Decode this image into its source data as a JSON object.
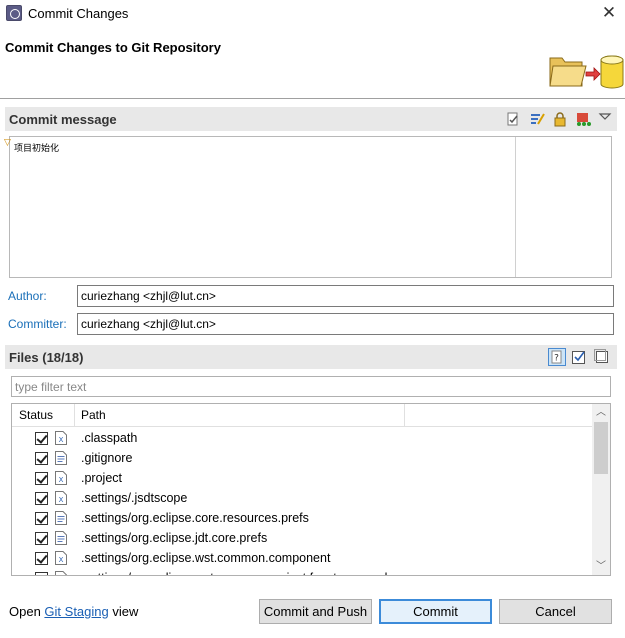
{
  "window": {
    "title": "Commit Changes",
    "close_glyph": "✕"
  },
  "banner": {
    "title": "Commit Changes to Git Repository",
    "icon": "folder-to-repository-icon"
  },
  "commit_message": {
    "header": "Commit message",
    "toolbar_icons": [
      "spell-check-icon",
      "amend-icon",
      "sign-off-icon",
      "commit-settings-icon",
      "dropdown-icon"
    ],
    "text": "项目初始化",
    "marker": "▽"
  },
  "author": {
    "label": "Author:",
    "value": "curiezhang <zhjl@lut.cn>"
  },
  "committer": {
    "label": "Committer:",
    "value": "curiezhang <zhjl@lut.cn>"
  },
  "files": {
    "header": "Files (18/18)",
    "toolbar_icons": [
      "show-untracked-icon",
      "select-all-icon",
      "deselect-all-icon"
    ],
    "filter_placeholder": "type filter text",
    "columns": {
      "status": "Status",
      "path": "Path"
    },
    "rows": [
      {
        "name": ".classpath",
        "icon": "xml-file-icon",
        "checked": true
      },
      {
        "name": ".gitignore",
        "icon": "text-file-icon",
        "checked": true
      },
      {
        "name": ".project",
        "icon": "xml-file-icon",
        "checked": true
      },
      {
        "name": ".settings/.jsdtscope",
        "icon": "xml-file-icon",
        "checked": true
      },
      {
        "name": ".settings/org.eclipse.core.resources.prefs",
        "icon": "text-file-icon",
        "checked": true
      },
      {
        "name": ".settings/org.eclipse.jdt.core.prefs",
        "icon": "text-file-icon",
        "checked": true
      },
      {
        "name": ".settings/org.eclipse.wst.common.component",
        "icon": "xml-file-icon",
        "checked": true
      },
      {
        "name": ".settings/org.eclipse.wst.common.project.facet.core.xml",
        "icon": "xml-file-icon",
        "checked": true
      }
    ]
  },
  "footer": {
    "open_prefix": "Open ",
    "open_link": "Git Staging",
    "open_suffix": " view",
    "commit_and_push": "Commit and Push",
    "commit": "Commit",
    "cancel": "Cancel"
  },
  "colors": {
    "link": "#1a5fb4",
    "label": "#1a6fb8",
    "default_button_border": "#3c8bd9"
  }
}
